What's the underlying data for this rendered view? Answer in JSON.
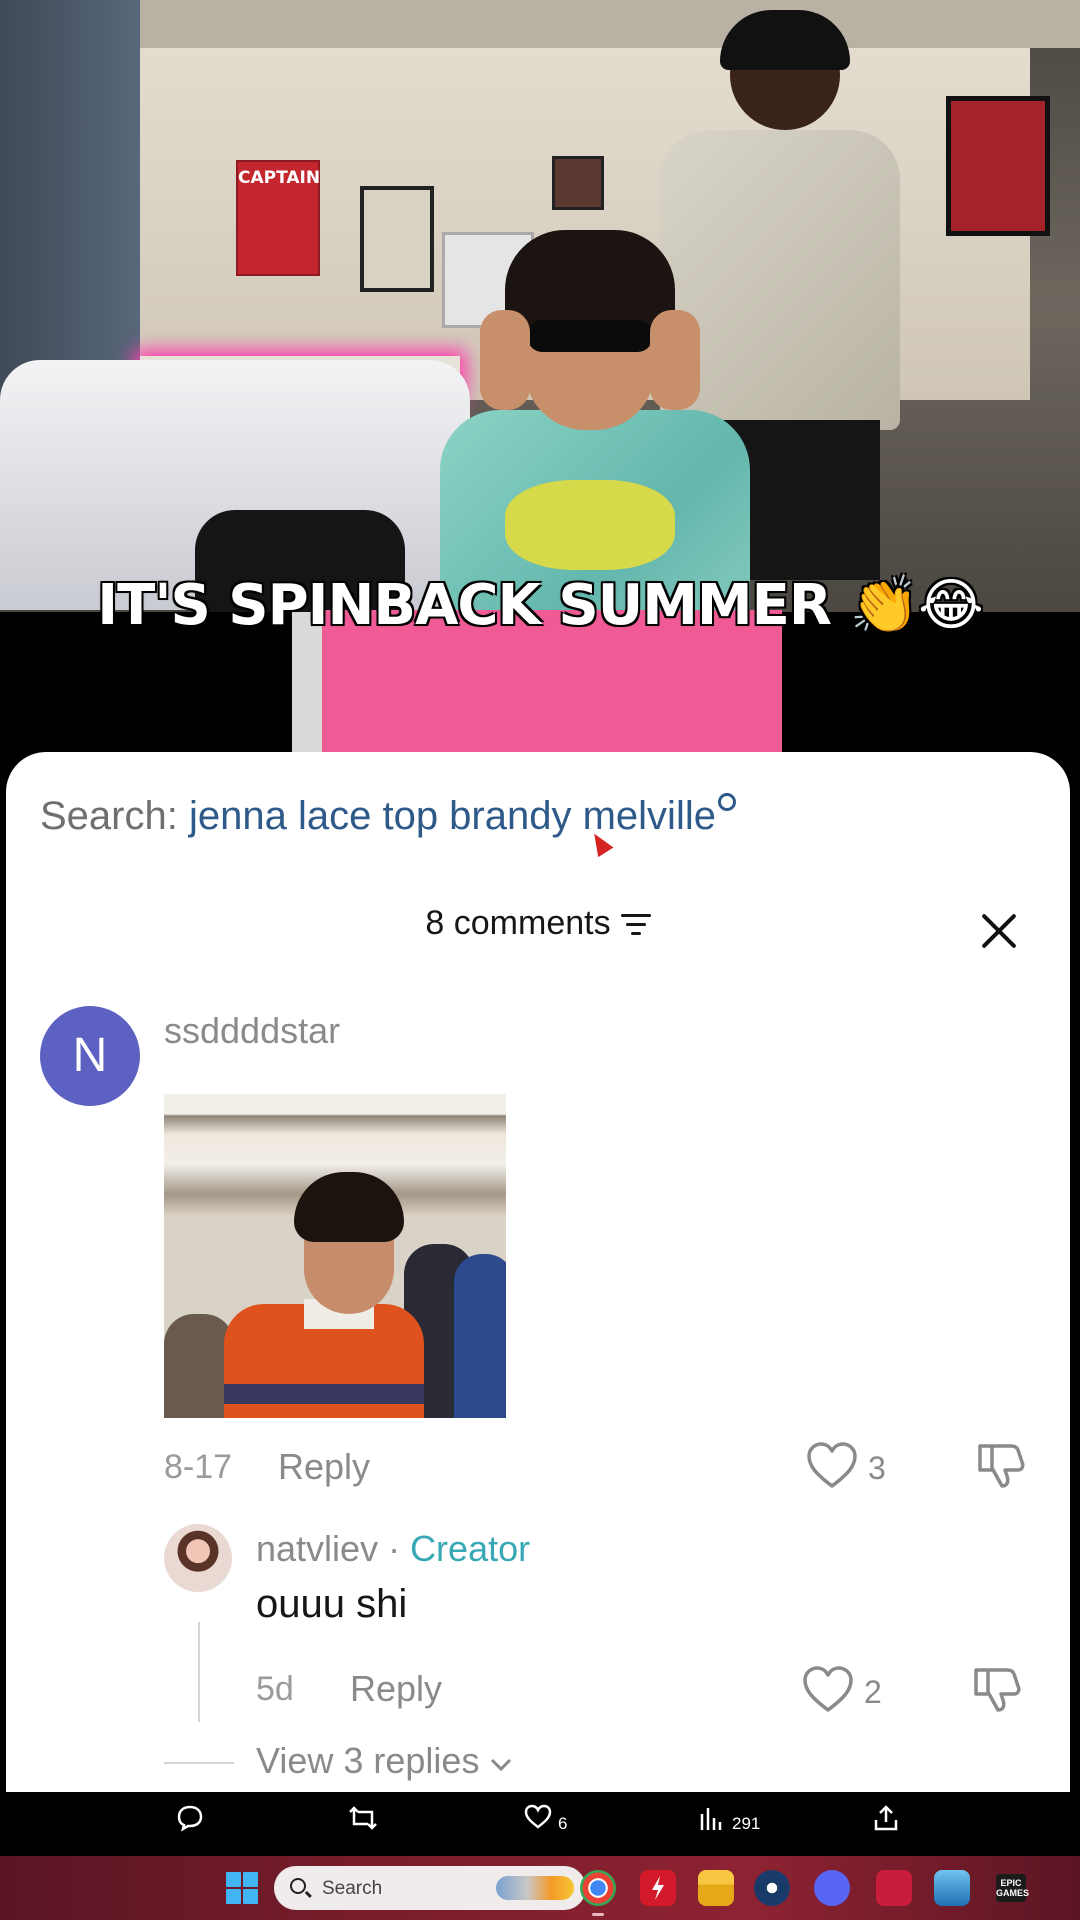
{
  "video": {
    "caption": "IT'S SPINBACK SUMMER 👏😂",
    "poster_text": "CAPTAIN"
  },
  "comments_panel": {
    "search_prefix": "Search:",
    "search_query": "jenna lace top brandy melville",
    "comments_count_label": "8 comments",
    "comments": [
      {
        "avatar_letter": "N",
        "avatar_color": "#5d61c2",
        "username": "ssddddstar",
        "has_image": true,
        "date": "8-17",
        "reply_label": "Reply",
        "likes": "3"
      }
    ],
    "replies": [
      {
        "username": "natvliev",
        "separator": " · ",
        "badge": "Creator",
        "text": "ouuu shi",
        "date": "5d",
        "reply_label": "Reply",
        "likes": "2"
      }
    ],
    "view_replies_label": "View 3 replies"
  },
  "action_bar": {
    "likes": "6",
    "views": "291"
  },
  "taskbar": {
    "search_placeholder": "Search",
    "epic_label": "EPIC GAMES",
    "accent_color": "#7d1e2c"
  }
}
